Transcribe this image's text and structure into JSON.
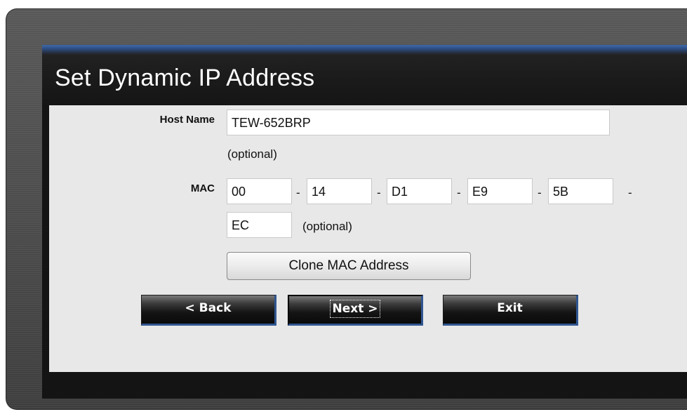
{
  "window": {
    "title": "Set Dynamic IP Address"
  },
  "form": {
    "host_name": {
      "label": "Host Name",
      "value": "TEW-652BRP",
      "note": "(optional)"
    },
    "mac": {
      "label": "MAC",
      "octets": [
        "00",
        "14",
        "D1",
        "E9",
        "5B",
        "EC"
      ],
      "separator": "-",
      "note": "(optional)"
    },
    "clone_button_label": "Clone MAC Address"
  },
  "nav": {
    "back_label": "< Back",
    "next_label": "Next >",
    "exit_label": "Exit"
  },
  "colors": {
    "title_accent": "#3f6aa8",
    "button_border_accent": "#2f5590",
    "content_bg": "#e8e8e8",
    "frame_bg": "#4b4b4b"
  }
}
